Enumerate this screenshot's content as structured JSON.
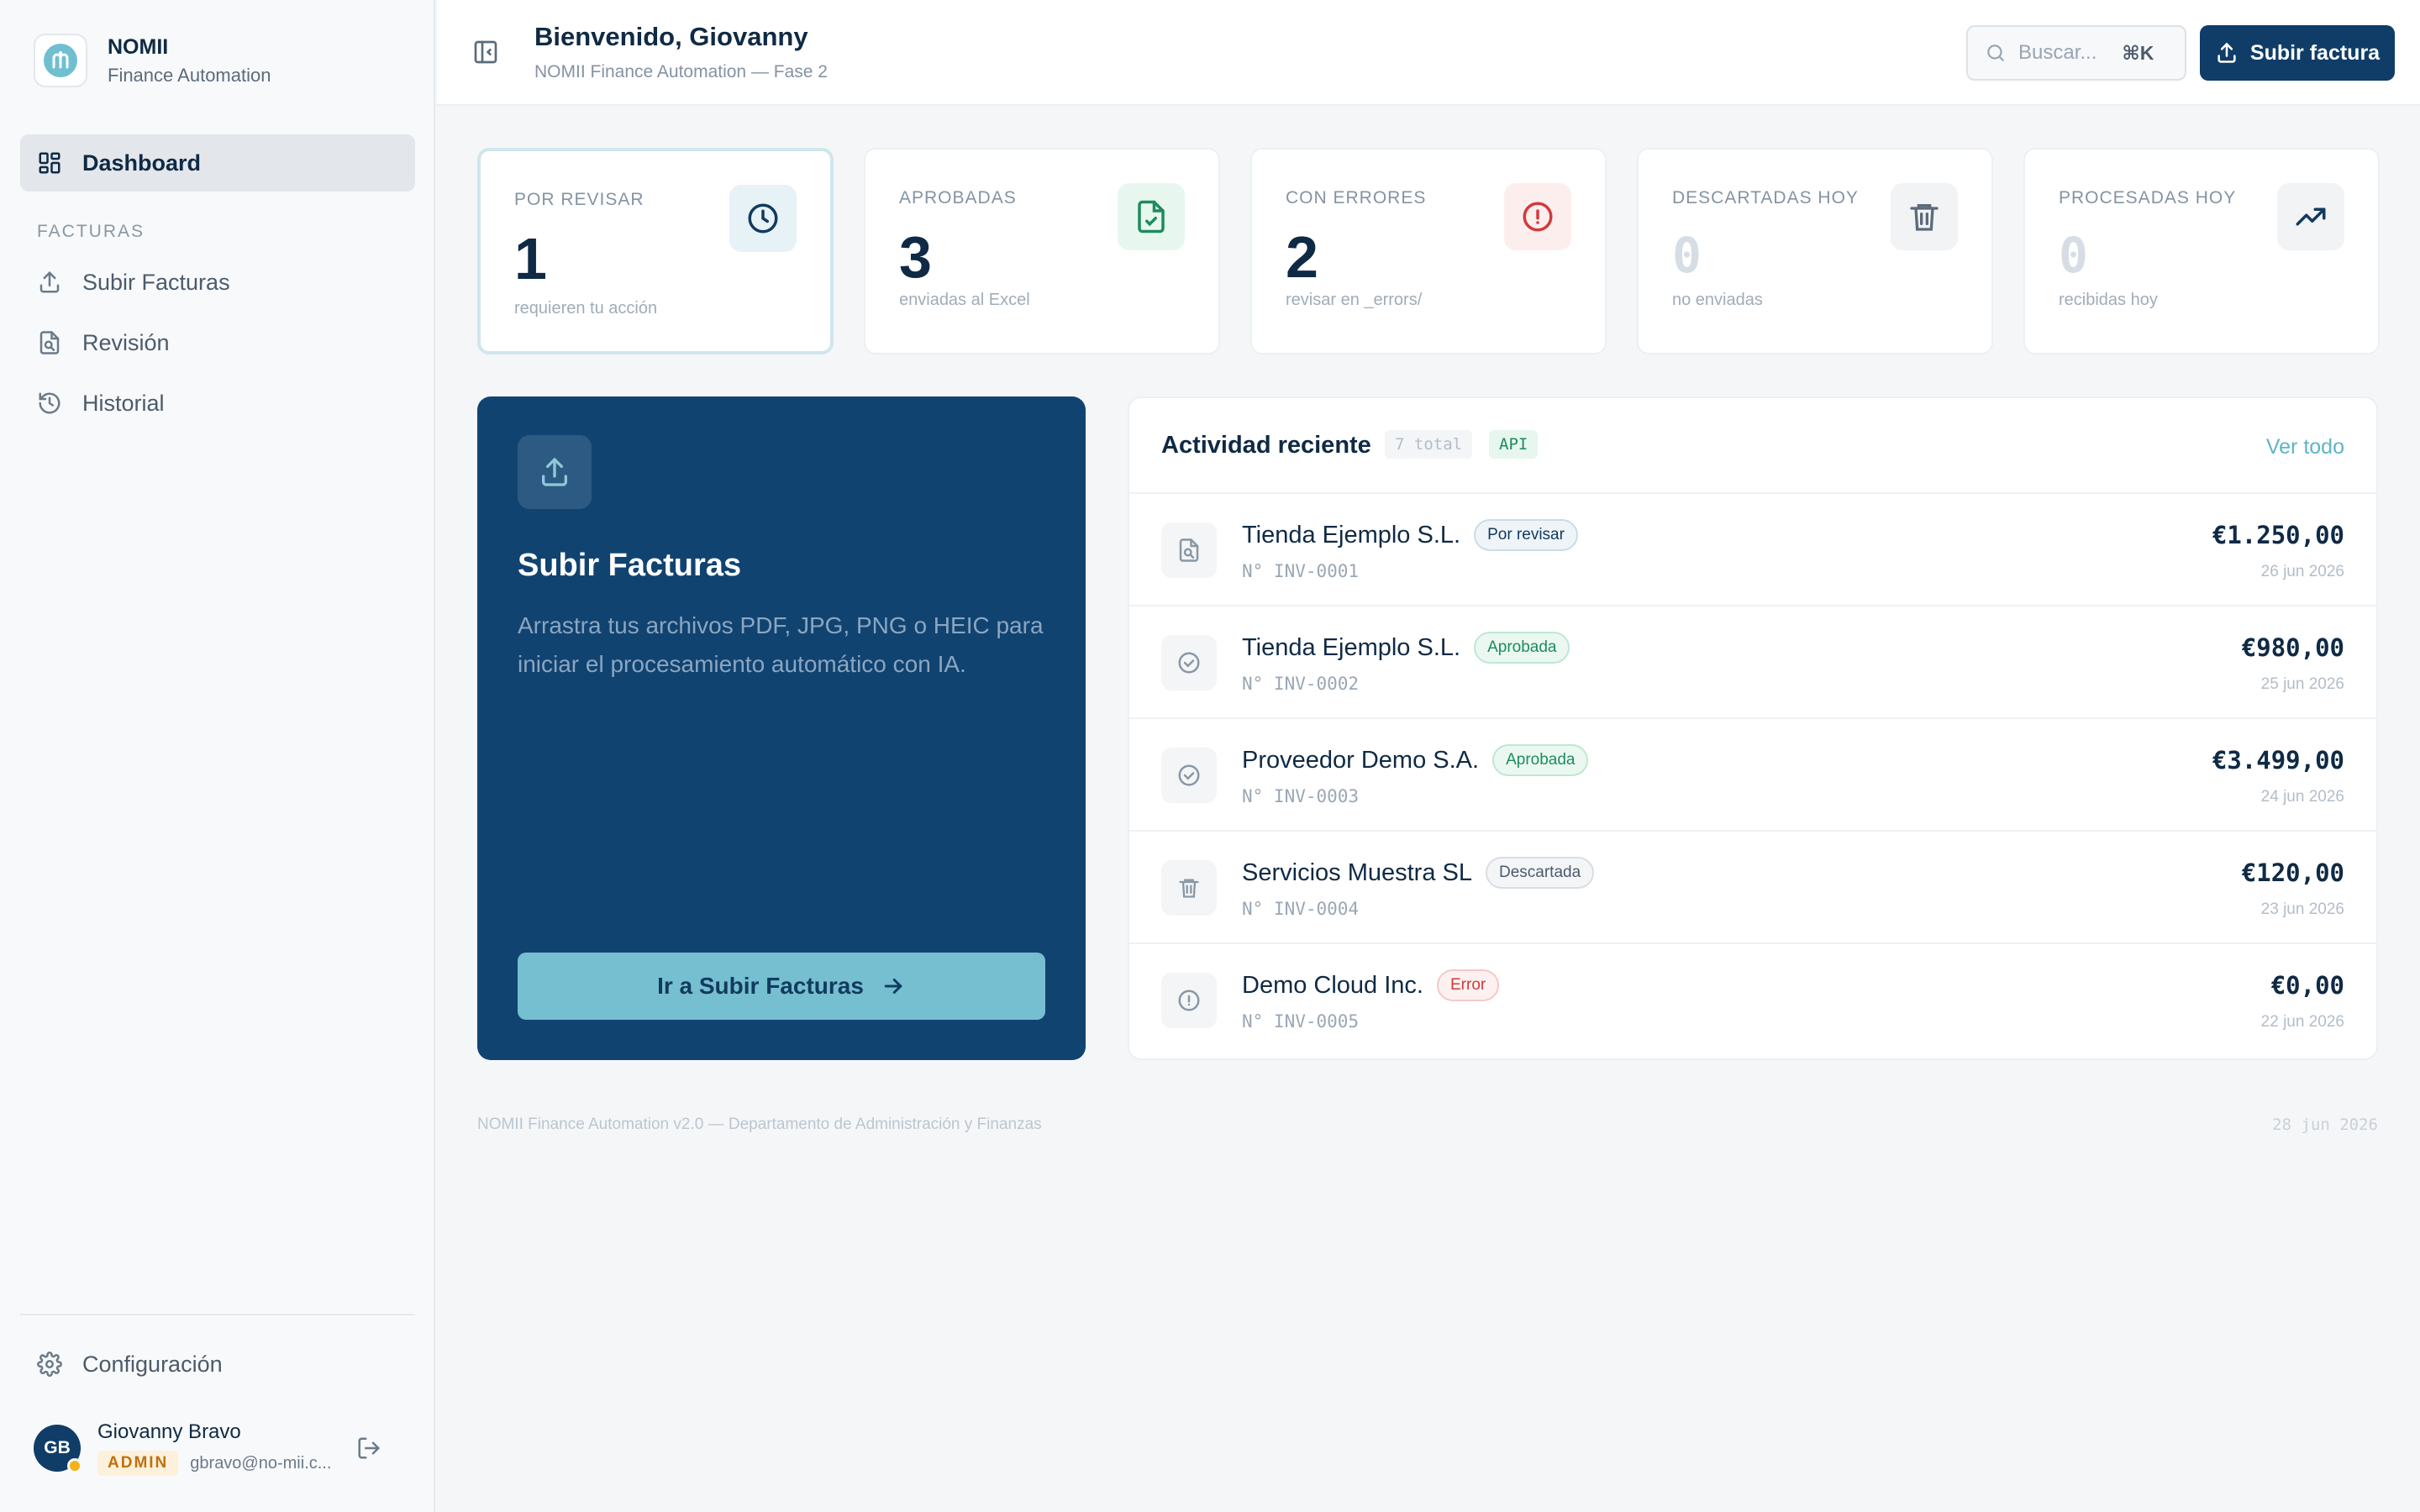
{
  "brand": {
    "name": "NOMII",
    "subtitle": "Finance Automation",
    "logo_color": "#6fbfd1"
  },
  "sidebar": {
    "active_item": "Dashboard",
    "section_label": "FACTURAS",
    "items": [
      {
        "label": "Subir Facturas",
        "icon": "upload-icon"
      },
      {
        "label": "Revisión",
        "icon": "file-review-icon"
      },
      {
        "label": "Historial",
        "icon": "history-icon"
      }
    ],
    "settings_label": "Configuración"
  },
  "user": {
    "initials": "GB",
    "name": "Giovanny Bravo",
    "role": "ADMIN",
    "email": "gbravo@no-mii.c..."
  },
  "header": {
    "welcome": "Bienvenido, Giovanny",
    "subtitle": "NOMII Finance Automation — Fase 2",
    "search_placeholder": "Buscar...",
    "search_shortcut": "⌘K",
    "upload_label": "Subir factura"
  },
  "stats": [
    {
      "title": "POR REVISAR",
      "value": "1",
      "note": "requieren tu acción",
      "icon": "clock-icon",
      "accent": "#e6f2f6"
    },
    {
      "title": "APROBADAS",
      "value": "3",
      "note": "enviadas al Excel",
      "icon": "file-check-icon",
      "accent": "#e7f7ef"
    },
    {
      "title": "CON ERRORES",
      "value": "2",
      "note": "revisar en _errors/",
      "icon": "alert-circle-icon",
      "accent": "#fdeeee"
    },
    {
      "title": "DESCARTADAS HOY",
      "value": "0",
      "note": "no enviadas",
      "icon": "trash-icon",
      "accent": "#f1f3f5"
    },
    {
      "title": "PROCESADAS HOY",
      "value": "0",
      "note": "recibidas hoy",
      "icon": "trending-up-icon",
      "accent": "#f1f3f5"
    }
  ],
  "hero": {
    "title": "Subir Facturas",
    "description": "Arrastra tus archivos PDF, JPG, PNG o HEIC para iniciar el procesamiento automático con IA.",
    "button_label": "Ir a Subir Facturas"
  },
  "activity": {
    "title": "Actividad reciente",
    "count": "7 total",
    "api_tag": "API",
    "view_all": "Ver todo",
    "rows": [
      {
        "vendor": "Tienda Ejemplo S.L.",
        "status": "Por revisar",
        "invoice": "N° INV-0001",
        "amount": "€1.250,00",
        "date": "26 jun 2026"
      },
      {
        "vendor": "Tienda Ejemplo S.L.",
        "status": "Aprobada",
        "invoice": "N° INV-0002",
        "amount": "€980,00",
        "date": "25 jun 2026"
      },
      {
        "vendor": "Proveedor Demo S.A.",
        "status": "Aprobada",
        "invoice": "N° INV-0003",
        "amount": "€3.499,00",
        "date": "24 jun 2026"
      },
      {
        "vendor": "Servicios Muestra SL",
        "status": "Descartada",
        "invoice": "N° INV-0004",
        "amount": "€120,00",
        "date": "23 jun 2026"
      },
      {
        "vendor": "Demo Cloud Inc.",
        "status": "Error",
        "invoice": "N° INV-0005",
        "amount": "€0,00",
        "date": "22 jun 2026"
      }
    ]
  },
  "footer": {
    "left": "NOMII Finance Automation v2.0 — Departamento de Administración y Finanzas",
    "right": "28 jun 2026"
  }
}
